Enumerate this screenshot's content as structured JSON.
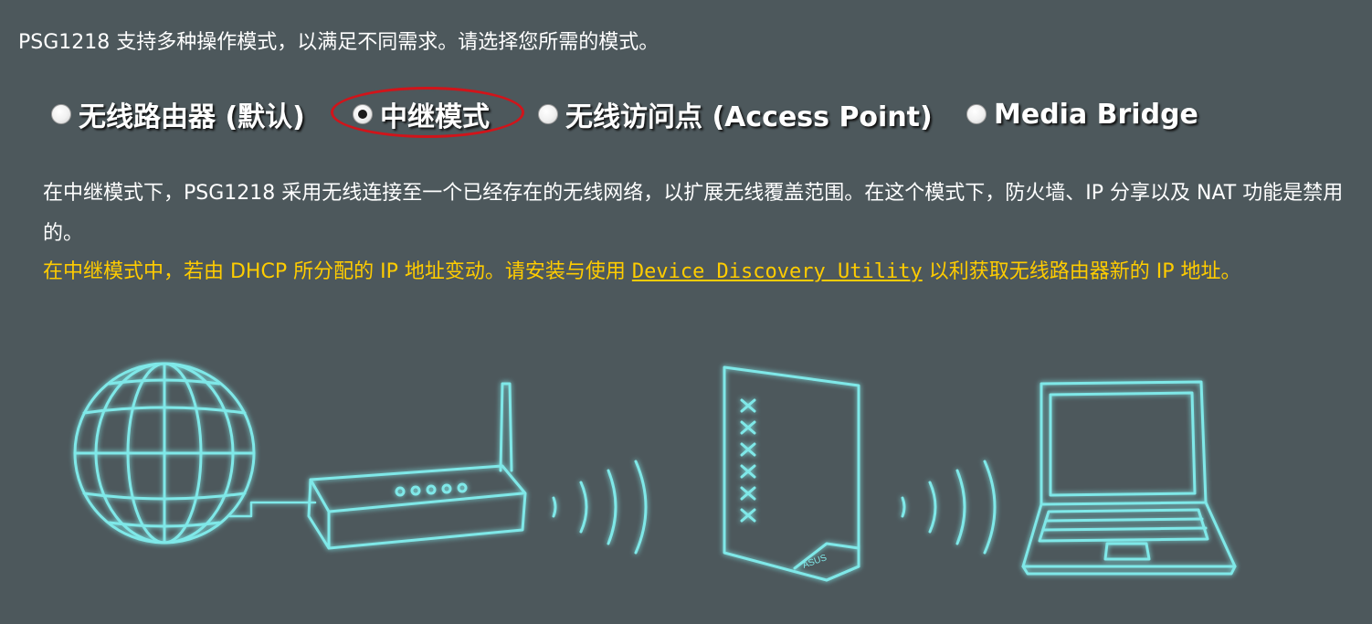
{
  "intro_text": "PSG1218 支持多种操作模式，以满足不同需求。请选择您所需的模式。",
  "modes": [
    {
      "label": "无线路由器 (默认)",
      "checked": false
    },
    {
      "label": "中继模式",
      "checked": true
    },
    {
      "label": "无线访问点 (Access Point)",
      "checked": false
    },
    {
      "label": "Media Bridge",
      "checked": false
    }
  ],
  "description": "在中继模式下，PSG1218 采用无线连接至一个已经存在的无线网络，以扩展无线覆盖范围。在这个模式下，防火墙、IP 分享以及 NAT 功能是禁用的。",
  "note": {
    "before": "在中继模式中，若由 DHCP 所分配的 IP 地址变动。请安装与使用 ",
    "link": "Device Discovery Utility",
    "after": " 以利获取无线路由器新的 IP 地址。"
  },
  "illustration": {
    "devices": [
      "globe-icon",
      "router-icon",
      "repeater-icon",
      "laptop-icon"
    ],
    "glow_color": "#7fe8e8",
    "brand_mark": "ASUS"
  },
  "colors": {
    "background": "#4d585c",
    "text": "#ffffff",
    "note": "#ffcc00",
    "highlight": "#d1141a"
  }
}
